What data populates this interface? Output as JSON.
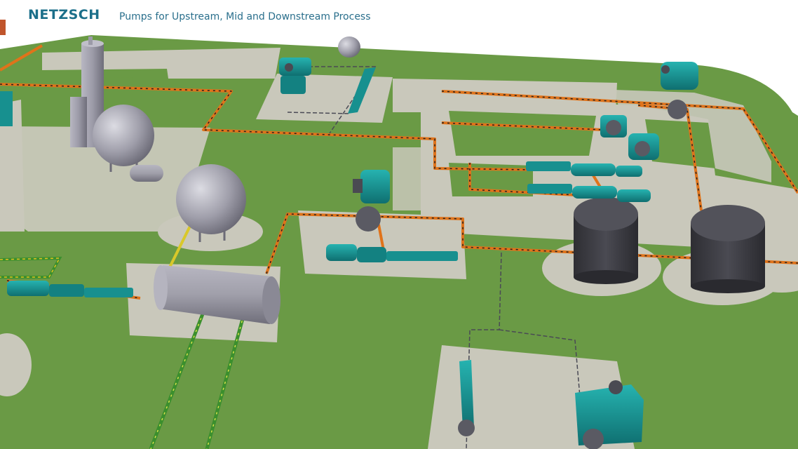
{
  "brand": {
    "logo_text": "NETZSCH"
  },
  "header": {
    "subtitle": "Pumps for Upstream, Mid and Downstream Process"
  },
  "colors": {
    "ground": "#6a9a45",
    "pad": "#c9c8bb",
    "pipe_orange": "#e0731a",
    "pipe_green": "#3b8f2d",
    "pipe_yellow": "#d9c82a",
    "pump_teal": "#17908f",
    "vessel_grey": "#8f8e99",
    "tank_dark": "#3a3a40"
  },
  "scene": {
    "pumps": [
      {
        "name": "pump-unit-top-center"
      },
      {
        "name": "pump-unit-top-right-a"
      },
      {
        "name": "pump-unit-top-right-b"
      },
      {
        "name": "pump-unit-top-right-c"
      },
      {
        "name": "pump-unit-center"
      },
      {
        "name": "pump-unit-bottom-right"
      }
    ],
    "progressive_cavity_pumps": [
      {
        "name": "pc-pump-top-center"
      },
      {
        "name": "pc-pump-right-a"
      },
      {
        "name": "pc-pump-right-b"
      },
      {
        "name": "pc-pump-center"
      },
      {
        "name": "pc-pump-left"
      },
      {
        "name": "pc-pump-bottom-vertical"
      }
    ],
    "vessels": [
      {
        "name": "distillation-column"
      },
      {
        "name": "sphere-tank-left"
      },
      {
        "name": "sphere-tank-center"
      },
      {
        "name": "horizontal-drum"
      },
      {
        "name": "small-horizontal-drum"
      },
      {
        "name": "small-sphere-top"
      }
    ],
    "storage_tanks": [
      {
        "name": "storage-tank-a"
      },
      {
        "name": "storage-tank-b"
      }
    ]
  }
}
